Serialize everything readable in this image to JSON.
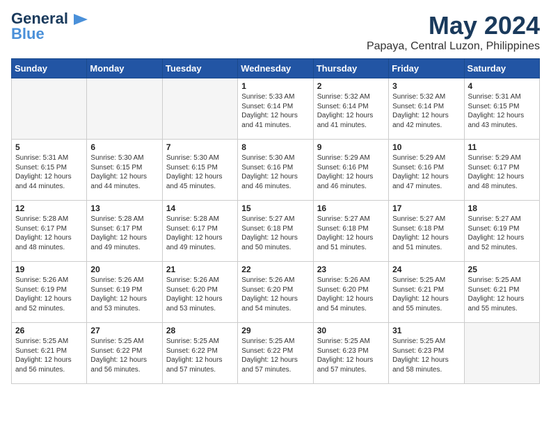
{
  "header": {
    "logo": {
      "line1": "General",
      "line2": "Blue"
    },
    "month": "May 2024",
    "location": "Papaya, Central Luzon, Philippines"
  },
  "days_of_week": [
    "Sunday",
    "Monday",
    "Tuesday",
    "Wednesday",
    "Thursday",
    "Friday",
    "Saturday"
  ],
  "weeks": [
    [
      {
        "day": "",
        "empty": true
      },
      {
        "day": "",
        "empty": true
      },
      {
        "day": "",
        "empty": true
      },
      {
        "day": "1",
        "sunrise": "5:33 AM",
        "sunset": "6:14 PM",
        "daylight": "12 hours and 41 minutes."
      },
      {
        "day": "2",
        "sunrise": "5:32 AM",
        "sunset": "6:14 PM",
        "daylight": "12 hours and 41 minutes."
      },
      {
        "day": "3",
        "sunrise": "5:32 AM",
        "sunset": "6:14 PM",
        "daylight": "12 hours and 42 minutes."
      },
      {
        "day": "4",
        "sunrise": "5:31 AM",
        "sunset": "6:15 PM",
        "daylight": "12 hours and 43 minutes."
      }
    ],
    [
      {
        "day": "5",
        "sunrise": "5:31 AM",
        "sunset": "6:15 PM",
        "daylight": "12 hours and 44 minutes."
      },
      {
        "day": "6",
        "sunrise": "5:30 AM",
        "sunset": "6:15 PM",
        "daylight": "12 hours and 44 minutes."
      },
      {
        "day": "7",
        "sunrise": "5:30 AM",
        "sunset": "6:15 PM",
        "daylight": "12 hours and 45 minutes."
      },
      {
        "day": "8",
        "sunrise": "5:30 AM",
        "sunset": "6:16 PM",
        "daylight": "12 hours and 46 minutes."
      },
      {
        "day": "9",
        "sunrise": "5:29 AM",
        "sunset": "6:16 PM",
        "daylight": "12 hours and 46 minutes."
      },
      {
        "day": "10",
        "sunrise": "5:29 AM",
        "sunset": "6:16 PM",
        "daylight": "12 hours and 47 minutes."
      },
      {
        "day": "11",
        "sunrise": "5:29 AM",
        "sunset": "6:17 PM",
        "daylight": "12 hours and 48 minutes."
      }
    ],
    [
      {
        "day": "12",
        "sunrise": "5:28 AM",
        "sunset": "6:17 PM",
        "daylight": "12 hours and 48 minutes."
      },
      {
        "day": "13",
        "sunrise": "5:28 AM",
        "sunset": "6:17 PM",
        "daylight": "12 hours and 49 minutes."
      },
      {
        "day": "14",
        "sunrise": "5:28 AM",
        "sunset": "6:17 PM",
        "daylight": "12 hours and 49 minutes."
      },
      {
        "day": "15",
        "sunrise": "5:27 AM",
        "sunset": "6:18 PM",
        "daylight": "12 hours and 50 minutes."
      },
      {
        "day": "16",
        "sunrise": "5:27 AM",
        "sunset": "6:18 PM",
        "daylight": "12 hours and 51 minutes."
      },
      {
        "day": "17",
        "sunrise": "5:27 AM",
        "sunset": "6:18 PM",
        "daylight": "12 hours and 51 minutes."
      },
      {
        "day": "18",
        "sunrise": "5:27 AM",
        "sunset": "6:19 PM",
        "daylight": "12 hours and 52 minutes."
      }
    ],
    [
      {
        "day": "19",
        "sunrise": "5:26 AM",
        "sunset": "6:19 PM",
        "daylight": "12 hours and 52 minutes."
      },
      {
        "day": "20",
        "sunrise": "5:26 AM",
        "sunset": "6:19 PM",
        "daylight": "12 hours and 53 minutes."
      },
      {
        "day": "21",
        "sunrise": "5:26 AM",
        "sunset": "6:20 PM",
        "daylight": "12 hours and 53 minutes."
      },
      {
        "day": "22",
        "sunrise": "5:26 AM",
        "sunset": "6:20 PM",
        "daylight": "12 hours and 54 minutes."
      },
      {
        "day": "23",
        "sunrise": "5:26 AM",
        "sunset": "6:20 PM",
        "daylight": "12 hours and 54 minutes."
      },
      {
        "day": "24",
        "sunrise": "5:25 AM",
        "sunset": "6:21 PM",
        "daylight": "12 hours and 55 minutes."
      },
      {
        "day": "25",
        "sunrise": "5:25 AM",
        "sunset": "6:21 PM",
        "daylight": "12 hours and 55 minutes."
      }
    ],
    [
      {
        "day": "26",
        "sunrise": "5:25 AM",
        "sunset": "6:21 PM",
        "daylight": "12 hours and 56 minutes."
      },
      {
        "day": "27",
        "sunrise": "5:25 AM",
        "sunset": "6:22 PM",
        "daylight": "12 hours and 56 minutes."
      },
      {
        "day": "28",
        "sunrise": "5:25 AM",
        "sunset": "6:22 PM",
        "daylight": "12 hours and 57 minutes."
      },
      {
        "day": "29",
        "sunrise": "5:25 AM",
        "sunset": "6:22 PM",
        "daylight": "12 hours and 57 minutes."
      },
      {
        "day": "30",
        "sunrise": "5:25 AM",
        "sunset": "6:23 PM",
        "daylight": "12 hours and 57 minutes."
      },
      {
        "day": "31",
        "sunrise": "5:25 AM",
        "sunset": "6:23 PM",
        "daylight": "12 hours and 58 minutes."
      },
      {
        "day": "",
        "empty": true
      }
    ]
  ],
  "labels": {
    "sunrise": "Sunrise:",
    "sunset": "Sunset:",
    "daylight": "Daylight:"
  }
}
